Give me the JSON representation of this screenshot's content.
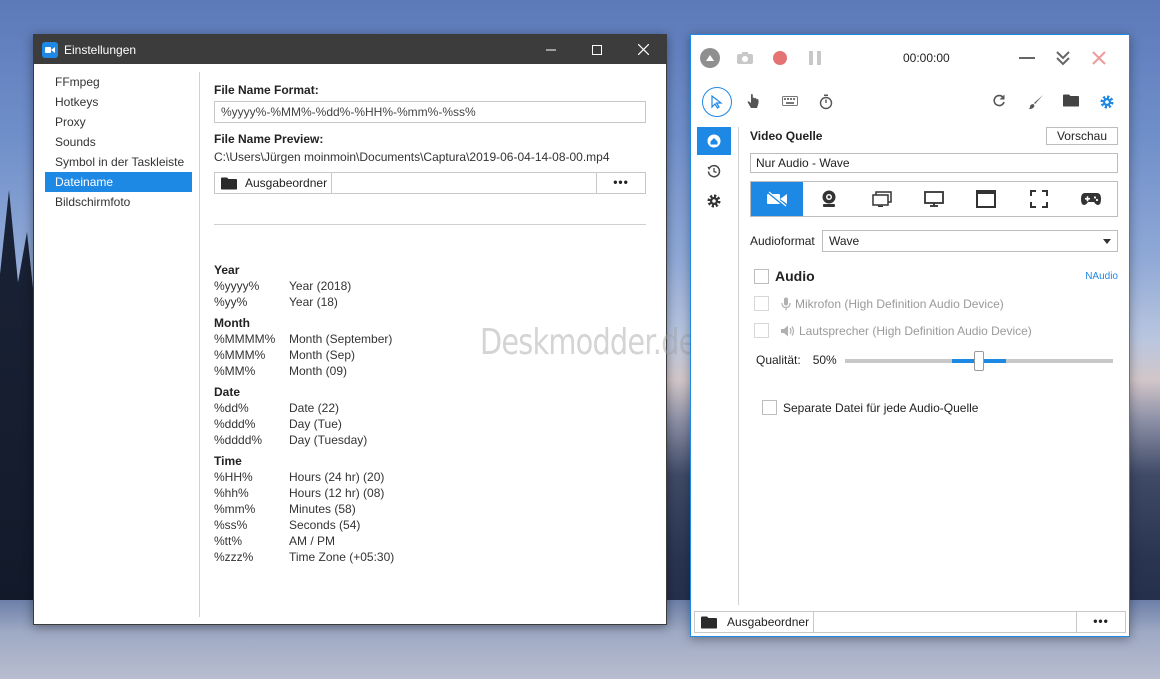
{
  "settings_window": {
    "title": "Einstellungen",
    "sidebar": [
      {
        "label": "FFmpeg"
      },
      {
        "label": "Hotkeys"
      },
      {
        "label": "Proxy"
      },
      {
        "label": "Sounds"
      },
      {
        "label": "Symbol in der Taskleiste"
      },
      {
        "label": "Dateiname",
        "active": true
      },
      {
        "label": "Bildschirmfoto"
      }
    ],
    "file_name_format_label": "File Name Format:",
    "file_name_format_value": "%yyyy%-%MM%-%dd%-%HH%-%mm%-%ss%",
    "file_name_preview_label": "File Name Preview:",
    "file_name_preview_value": "C:\\Users\\Jürgen moinmoin\\Documents\\Captura\\2019-06-04-14-08-00.mp4",
    "output_folder_label": "Ausgabeordner",
    "output_folder_path": "",
    "more_label": "•••",
    "format_groups": [
      {
        "title": "Year",
        "rows": [
          {
            "code": "%yyyy%",
            "desc": "Year (2018)"
          },
          {
            "code": "%yy%",
            "desc": "Year (18)"
          }
        ]
      },
      {
        "title": "Month",
        "rows": [
          {
            "code": "%MMMM%",
            "desc": "Month (September)"
          },
          {
            "code": "%MMM%",
            "desc": "Month (Sep)"
          },
          {
            "code": "%MM%",
            "desc": "Month (09)"
          }
        ]
      },
      {
        "title": "Date",
        "rows": [
          {
            "code": "%dd%",
            "desc": "Date (22)"
          },
          {
            "code": "%ddd%",
            "desc": "Day (Tue)"
          },
          {
            "code": "%dddd%",
            "desc": "Day (Tuesday)"
          }
        ]
      },
      {
        "title": "Time",
        "rows": [
          {
            "code": "%HH%",
            "desc": "Hours (24 hr) (20)"
          },
          {
            "code": "%hh%",
            "desc": "Hours (12 hr) (08)"
          },
          {
            "code": "%mm%",
            "desc": "Minutes (58)"
          },
          {
            "code": "%ss%",
            "desc": "Seconds (54)"
          },
          {
            "code": "%tt%",
            "desc": "AM / PM"
          },
          {
            "code": "%zzz%",
            "desc": "Time Zone (+05:30)"
          }
        ]
      }
    ]
  },
  "watermark": "Deskmodder.de",
  "captura": {
    "timer": "00:00:00",
    "video_source_label": "Video Quelle",
    "preview_button": "Vorschau",
    "video_source_value": "Nur Audio  -  Wave",
    "audio_format_label": "Audioformat",
    "audio_format_value": "Wave",
    "audio_label": "Audio",
    "naudio_label": "NAudio",
    "microphone_label": "Mikrofon (High Definition Audio Device)",
    "speaker_label": "Lautsprecher (High Definition Audio Device)",
    "quality_label": "Qualität:",
    "quality_value": "50%",
    "quality_fraction": 0.5,
    "separate_file_label": "Separate Datei für jede Audio-Quelle",
    "output_folder_label": "Ausgabeordner",
    "more_label": "•••"
  },
  "colors": {
    "accent": "#1e88e5",
    "titlebar": "#3c3c3c",
    "close_red": "#e57373"
  }
}
